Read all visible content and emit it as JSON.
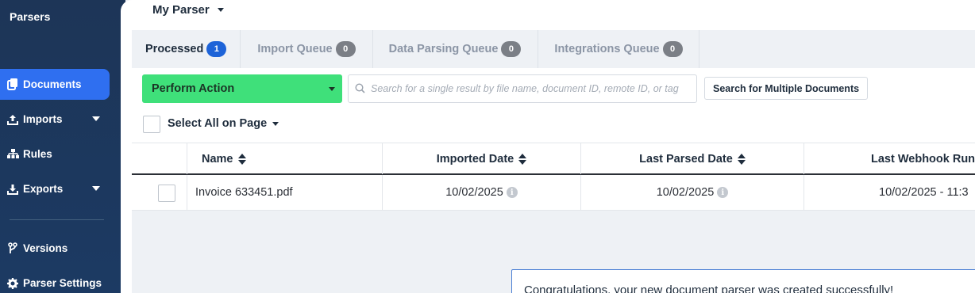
{
  "sidebar": {
    "brand": "Parsers",
    "items": [
      {
        "label": "Documents",
        "icon": "documents-icon",
        "active": true
      },
      {
        "label": "Imports",
        "icon": "upload-icon",
        "has_caret": true
      },
      {
        "label": "Rules",
        "icon": "rules-icon"
      },
      {
        "label": "Exports",
        "icon": "download-icon",
        "has_caret": true
      },
      {
        "label": "Versions",
        "icon": "branch-icon"
      },
      {
        "label": "Parser Settings",
        "icon": "gear-icon"
      }
    ]
  },
  "header": {
    "parser_name": "My Parser"
  },
  "tabs": [
    {
      "label": "Processed",
      "count": "1",
      "active": true
    },
    {
      "label": "Import Queue",
      "count": "0"
    },
    {
      "label": "Data Parsing Queue",
      "count": "0"
    },
    {
      "label": "Integrations Queue",
      "count": "0"
    }
  ],
  "toolbar": {
    "perform_action": "Perform Action",
    "search_placeholder": "Search for a single result by file name, document ID, remote ID, or tag",
    "multi_search": "Search for Multiple Documents",
    "select_all": "Select All on Page"
  },
  "table": {
    "columns": [
      "Name",
      "Imported Date",
      "Last Parsed Date",
      "Last Webhook Run"
    ],
    "rows": [
      {
        "name": "Invoice 633451.pdf",
        "imported": "10/02/2025",
        "parsed": "10/02/2025",
        "webhook": "10/02/2025 - 11:3"
      }
    ]
  },
  "toast": {
    "message": "Congratulations, your new document parser was created successfully!"
  },
  "colors": {
    "sidebar_bg": "#1d3557",
    "active_nav": "#2f6ff0",
    "perform_action": "#3fe07a",
    "badge_active": "#1d63d8",
    "badge_inactive": "#7b7f86",
    "toast_border": "#4a7fd4"
  }
}
